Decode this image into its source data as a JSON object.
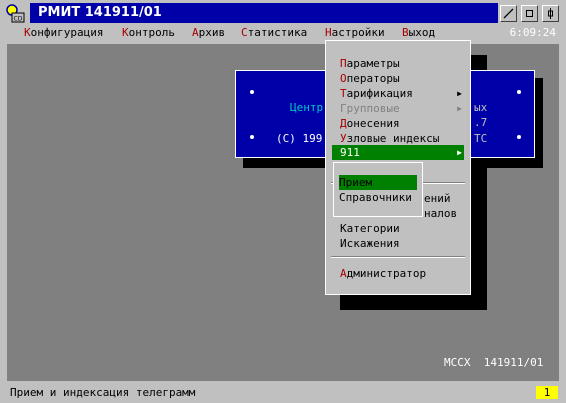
{
  "window": {
    "title": "РМИТ 141911/01"
  },
  "menubar": {
    "items": [
      {
        "hotkey": "К",
        "rest": "онфигурация"
      },
      {
        "hotkey": "К",
        "rest": "онтроль"
      },
      {
        "hotkey": "А",
        "rest": "рхив"
      },
      {
        "hotkey": "С",
        "rest": "татистика"
      },
      {
        "hotkey": "Н",
        "rest": "астройки"
      },
      {
        "hotkey": "В",
        "rest": "ыход"
      }
    ],
    "clock": "6:09:24"
  },
  "banner": {
    "line1": "Центр",
    "line2": "(C) 199",
    "right1": "ых",
    "right2": ".7",
    "right3": "ТС"
  },
  "dropdown": {
    "items": [
      {
        "hotkey": "П",
        "rest": "араметры"
      },
      {
        "hotkey": "О",
        "rest": "ператоры"
      },
      {
        "hotkey": "Т",
        "rest": "арификация",
        "arrow": "▶"
      },
      {
        "hotkey": "",
        "rest": "Групповые",
        "arrow": "▶",
        "disabled": true
      },
      {
        "hotkey": "Д",
        "rest": "онесения"
      },
      {
        "hotkey": "У",
        "rest": "зловые индексы"
      },
      {
        "hotkey": "",
        "rest": "911",
        "arrow": "▶",
        "selected": true
      },
      {
        "hotkey": "",
        "rest": "ений"
      },
      {
        "hotkey": "",
        "rest": "налов"
      },
      {
        "hotkey": "",
        "rest": "Категории"
      },
      {
        "hotkey": "",
        "rest": "Искажения"
      },
      {
        "hotkey": "А",
        "rest": "дминистратор"
      }
    ]
  },
  "submenu": {
    "items": [
      "Прием",
      "Справочники"
    ]
  },
  "desktop": {
    "label": "MCCX  141911/01"
  },
  "status": {
    "text": "Прием и индексация телеграмм",
    "number": "1"
  }
}
